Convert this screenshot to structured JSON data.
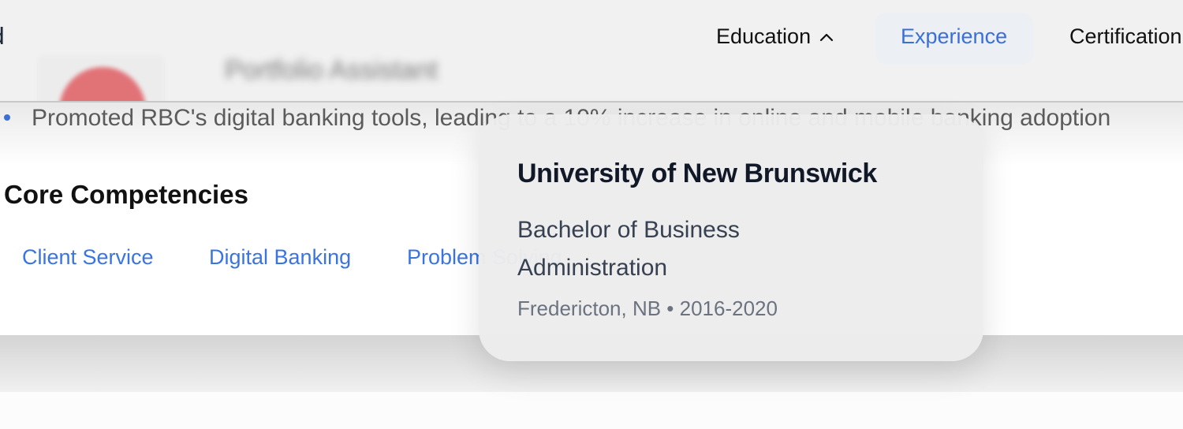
{
  "nav": {
    "brand_partial": "rd",
    "items": [
      {
        "label": "Education",
        "state": "open"
      },
      {
        "label": "Experience",
        "state": "active"
      },
      {
        "label": "Certification"
      }
    ],
    "chevron_icon": "chevron-up-icon",
    "active_color": "#3b6fd8"
  },
  "background": {
    "blurred_role": "Portfolio Assistant",
    "bullet_text": "Promoted RBC's digital banking tools, leading to a 10% increase in online and mobile banking adoption",
    "section_title": "Core Competencies",
    "chips": [
      "Client Service",
      "Digital Banking",
      "Problem Solving"
    ],
    "chip_color": "#3b74e0",
    "logo_accent": "#e05e63"
  },
  "education_dropdown": {
    "school": "University of New Brunswick",
    "degree": "Bachelor of Business Administration",
    "meta": "Fredericton, NB • 2016-2020"
  }
}
